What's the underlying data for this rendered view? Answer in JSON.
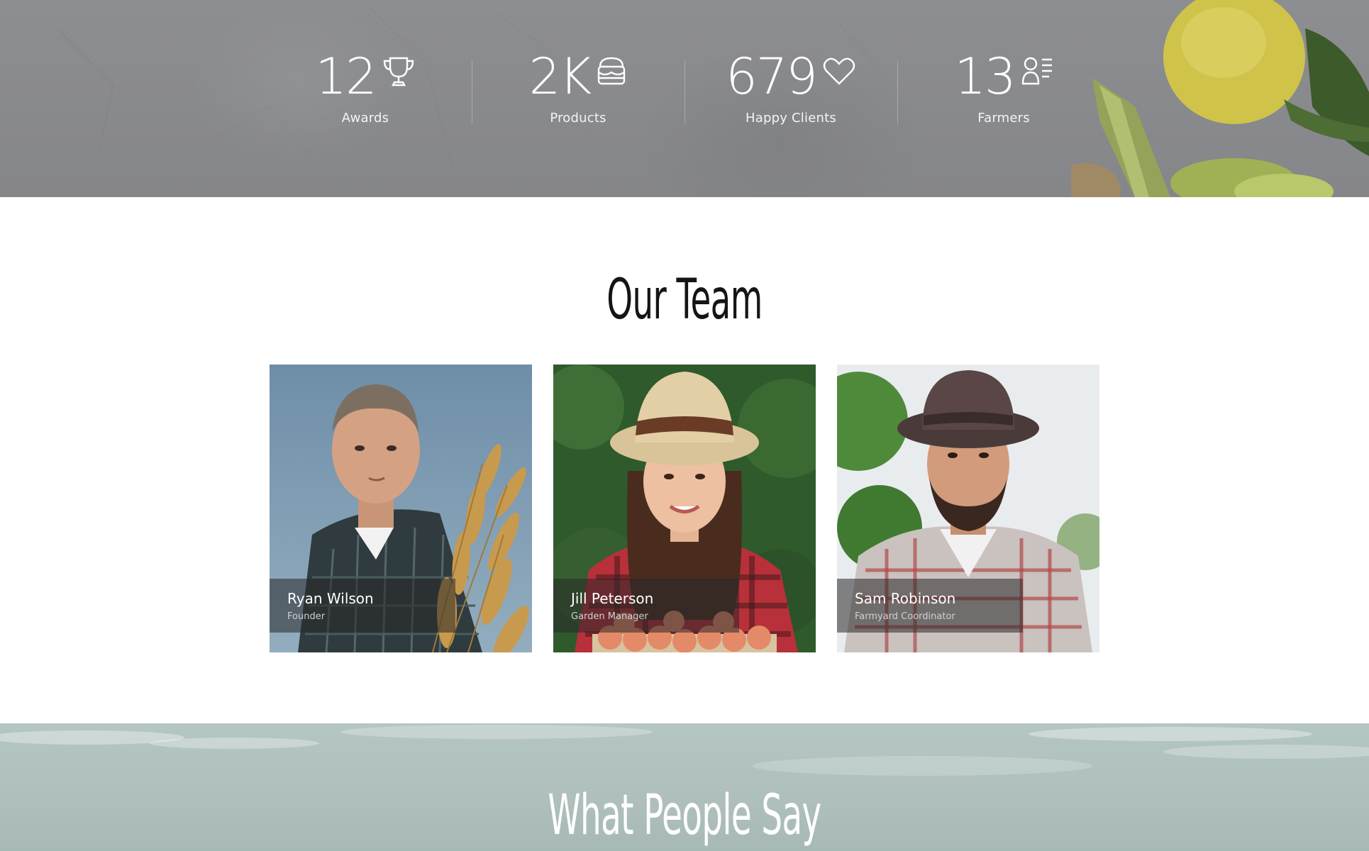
{
  "stats": [
    {
      "value": "12",
      "label": "Awards",
      "icon": "trophy-icon"
    },
    {
      "value": "2K",
      "label": "Products",
      "icon": "basket-icon"
    },
    {
      "value": "679",
      "label": "Happy Clients",
      "icon": "heart-icon"
    },
    {
      "value": "13",
      "label": "Farmers",
      "icon": "farmer-list-icon"
    }
  ],
  "team": {
    "title": "Our Team",
    "members": [
      {
        "name": "Ryan Wilson",
        "role": "Founder"
      },
      {
        "name": "Jill Peterson",
        "role": "Garden Manager"
      },
      {
        "name": "Sam Robinson",
        "role": "Farmyard Coordinator"
      }
    ]
  },
  "testimonials": {
    "title": "What People Say"
  },
  "colors": {
    "stats_bg": "#8a8b8e",
    "title_dark": "#151515",
    "caption_bg": "rgba(40,40,40,0.55)",
    "testimonials_bg": "#aebfbc"
  }
}
